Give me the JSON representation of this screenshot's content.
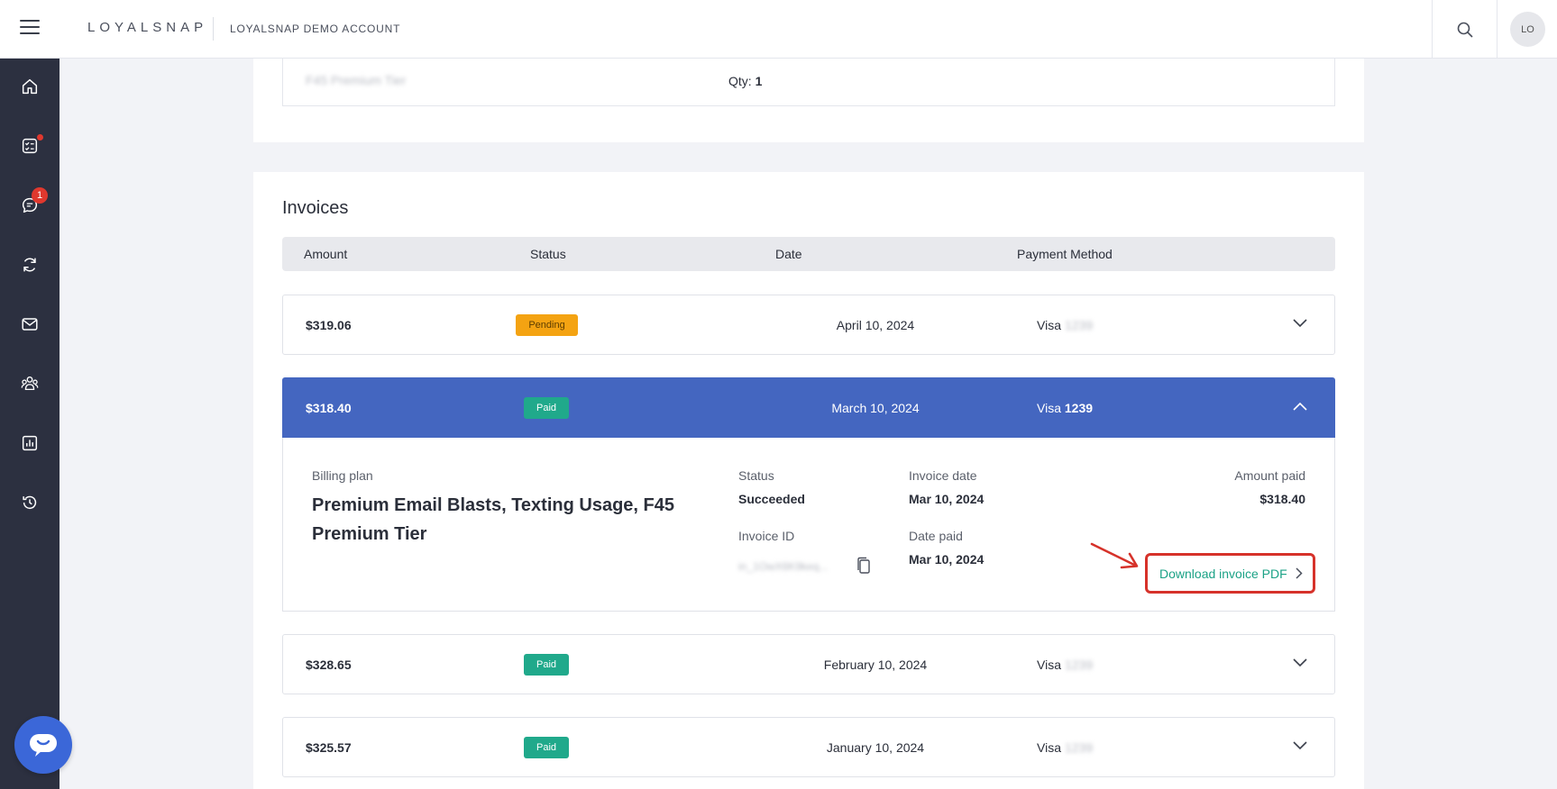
{
  "topbar": {
    "logo": "LOYALSNAP",
    "account": "LOYALSNAP DEMO ACCOUNT",
    "avatar_initials": "LO"
  },
  "sidebar": {
    "items": [
      {
        "icon": "home-icon"
      },
      {
        "icon": "tasks-icon",
        "dot": true
      },
      {
        "icon": "chat-icon",
        "badge": "1"
      },
      {
        "icon": "refresh-icon"
      },
      {
        "icon": "mail-icon"
      },
      {
        "icon": "team-icon"
      },
      {
        "icon": "reports-icon"
      },
      {
        "icon": "history-icon"
      }
    ]
  },
  "subscription": {
    "plan_item": "F45 Premium Tier",
    "qty_label": "Qty:",
    "qty_value": "1"
  },
  "invoices": {
    "title": "Invoices",
    "columns": {
      "amount": "Amount",
      "status": "Status",
      "date": "Date",
      "payment_method": "Payment Method"
    },
    "rows": [
      {
        "amount": "$319.06",
        "status": "Pending",
        "date": "April 10, 2024",
        "card_brand": "Visa",
        "last4": "1239"
      },
      {
        "amount": "$318.40",
        "status": "Paid",
        "date": "March 10, 2024",
        "card_brand": "Visa",
        "last4": "1239"
      },
      {
        "amount": "$328.65",
        "status": "Paid",
        "date": "February 10, 2024",
        "card_brand": "Visa",
        "last4": "1239"
      },
      {
        "amount": "$325.57",
        "status": "Paid",
        "date": "January 10, 2024",
        "card_brand": "Visa",
        "last4": "1239"
      }
    ],
    "expanded": {
      "billing_plan_label": "Billing plan",
      "billing_plan_value": "Premium Email Blasts, Texting Usage, F45 Premium Tier",
      "status_label": "Status",
      "status_value": "Succeeded",
      "invoice_id_label": "Invoice ID",
      "invoice_id_value": "in_1OwX6K9keq...",
      "invoice_date_label": "Invoice date",
      "invoice_date_value": "Mar 10, 2024",
      "date_paid_label": "Date paid",
      "date_paid_value": "Mar 10, 2024",
      "amount_paid_label": "Amount paid",
      "amount_paid_value": "$318.40",
      "download_label": "Download invoice PDF"
    }
  },
  "colors": {
    "accent": "#4466c0",
    "paid": "#20a98b",
    "pending": "#f4a312",
    "highlight": "#d6322a",
    "sidebar": "#2c3040"
  }
}
